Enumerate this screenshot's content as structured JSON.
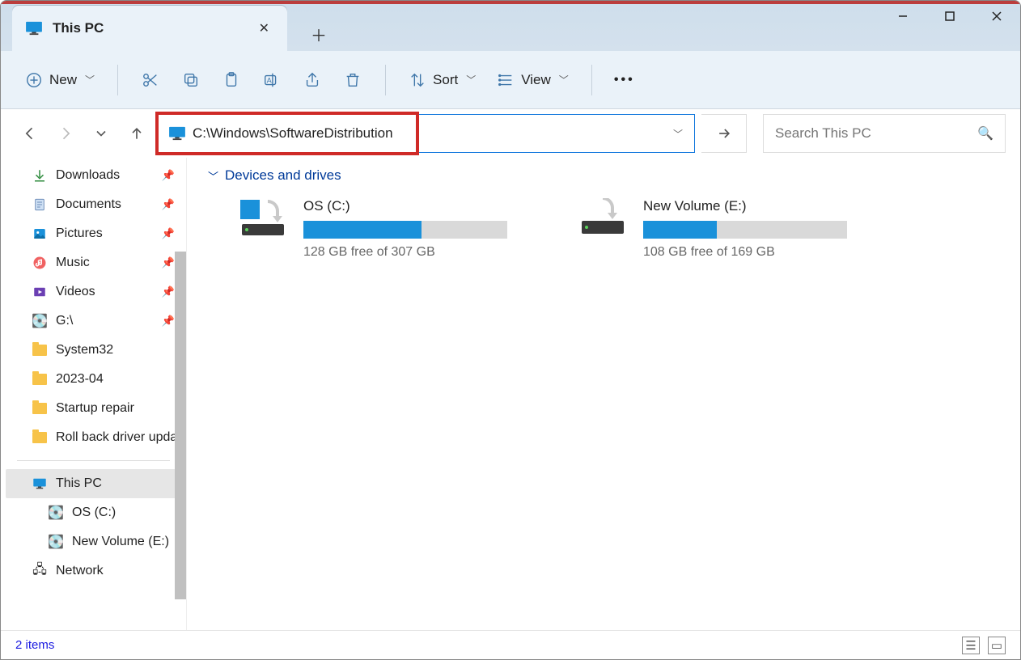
{
  "tab": {
    "title": "This PC"
  },
  "toolbar": {
    "new_label": "New",
    "sort_label": "Sort",
    "view_label": "View"
  },
  "address": {
    "value": "C:\\Windows\\SoftwareDistribution"
  },
  "search": {
    "placeholder": "Search This PC"
  },
  "sidebar": {
    "quick": [
      {
        "label": "Downloads",
        "icon": "download",
        "pinned": true
      },
      {
        "label": "Documents",
        "icon": "document",
        "pinned": true
      },
      {
        "label": "Pictures",
        "icon": "pictures",
        "pinned": true
      },
      {
        "label": "Music",
        "icon": "music",
        "pinned": true
      },
      {
        "label": "Videos",
        "icon": "videos",
        "pinned": true
      },
      {
        "label": "G:\\",
        "icon": "drive",
        "pinned": true
      },
      {
        "label": "System32",
        "icon": "folder"
      },
      {
        "label": "2023-04",
        "icon": "folder"
      },
      {
        "label": "Startup repair",
        "icon": "folder"
      },
      {
        "label": "Roll back driver update",
        "icon": "folder"
      }
    ],
    "thispc": {
      "label": "This PC",
      "children": [
        {
          "label": "OS (C:)"
        },
        {
          "label": "New Volume (E:)"
        }
      ]
    },
    "network": {
      "label": "Network"
    }
  },
  "section": {
    "title": "Devices and drives"
  },
  "drives": [
    {
      "name": "OS (C:)",
      "free_text": "128 GB free of 307 GB",
      "fill_pct": 58
    },
    {
      "name": "New Volume (E:)",
      "free_text": "108 GB free of 169 GB",
      "fill_pct": 36
    }
  ],
  "status": {
    "text": "2 items"
  }
}
